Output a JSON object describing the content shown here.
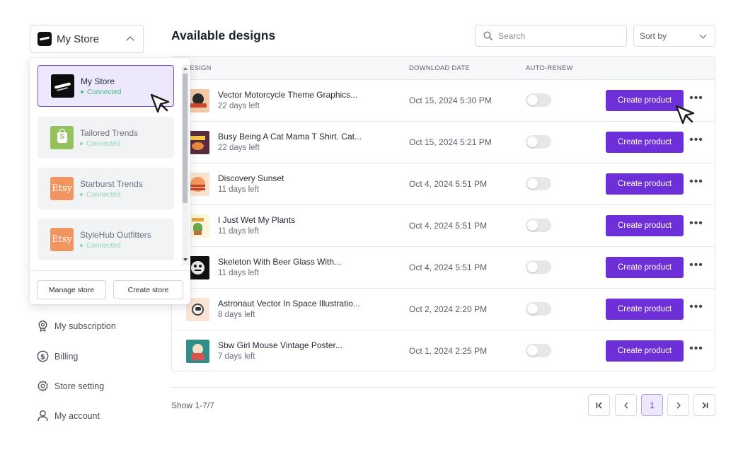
{
  "sidebar": {
    "store_select_label": "My Store",
    "stores": [
      {
        "name": "My Store",
        "status": "Connected",
        "platform": "custom",
        "active": true
      },
      {
        "name": "Tailored Trends",
        "status": "Connected",
        "platform": "shopify",
        "active": false
      },
      {
        "name": "Starburst Trends",
        "status": "Connected",
        "platform": "etsy",
        "active": false
      },
      {
        "name": "StyleHub Outfitters",
        "status": "Connected",
        "platform": "etsy",
        "active": false
      }
    ],
    "etsy_logo_text": "Etsy",
    "manage_store_label": "Manage store",
    "create_store_label": "Create store",
    "menu": [
      {
        "label": "My subscription",
        "icon": "badge-icon"
      },
      {
        "label": "Billing",
        "icon": "dollar-icon"
      },
      {
        "label": "Store setting",
        "icon": "gear-icon"
      },
      {
        "label": "My account",
        "icon": "user-icon"
      }
    ]
  },
  "main": {
    "title": "Available designs",
    "search_placeholder": "Search",
    "sort_label": "Sort by",
    "columns": [
      "DESIGN",
      "DOWNLOAD DATE",
      "AUTO-RENEW"
    ],
    "rows": [
      {
        "title": "Vector Motorcycle Theme Graphics...",
        "days_left": "22 days left",
        "date": "Oct 15, 2024 5:30 PM",
        "auto_renew": false,
        "action": "Create product"
      },
      {
        "title": "Busy Being A Cat Mama T Shirt. Cat...",
        "days_left": "22 days left",
        "date": "Oct 15, 2024 5:21 PM",
        "auto_renew": false,
        "action": "Create product"
      },
      {
        "title": "Discovery Sunset",
        "days_left": "11 days left",
        "date": "Oct 4, 2024 5:51 PM",
        "auto_renew": false,
        "action": "Create product"
      },
      {
        "title": "I Just Wet My Plants",
        "days_left": "11 days left",
        "date": "Oct 4, 2024 5:51 PM",
        "auto_renew": false,
        "action": "Create product"
      },
      {
        "title": "Skeleton With Beer Glass With...",
        "days_left": "11 days left",
        "date": "Oct 4, 2024 5:51 PM",
        "auto_renew": false,
        "action": "Create product"
      },
      {
        "title": "Astronaut Vector In Space Illustratio...",
        "days_left": "8 days left",
        "date": "Oct 2, 2024 2:20 PM",
        "auto_renew": false,
        "action": "Create product"
      },
      {
        "title": "Sbw Girl Mouse Vintage Poster...",
        "days_left": "7 days left",
        "date": "Oct 1, 2024 2:25 PM",
        "auto_renew": false,
        "action": "Create product"
      }
    ],
    "pagination": {
      "showing": "Show 1-7/7",
      "current_page": "1",
      "first": "|<",
      "prev": "<",
      "next": ">",
      "last": ">|"
    }
  },
  "colors": {
    "accent": "#6d2fd8",
    "connected": "#41b985",
    "active_bg": "#ede8fb"
  }
}
